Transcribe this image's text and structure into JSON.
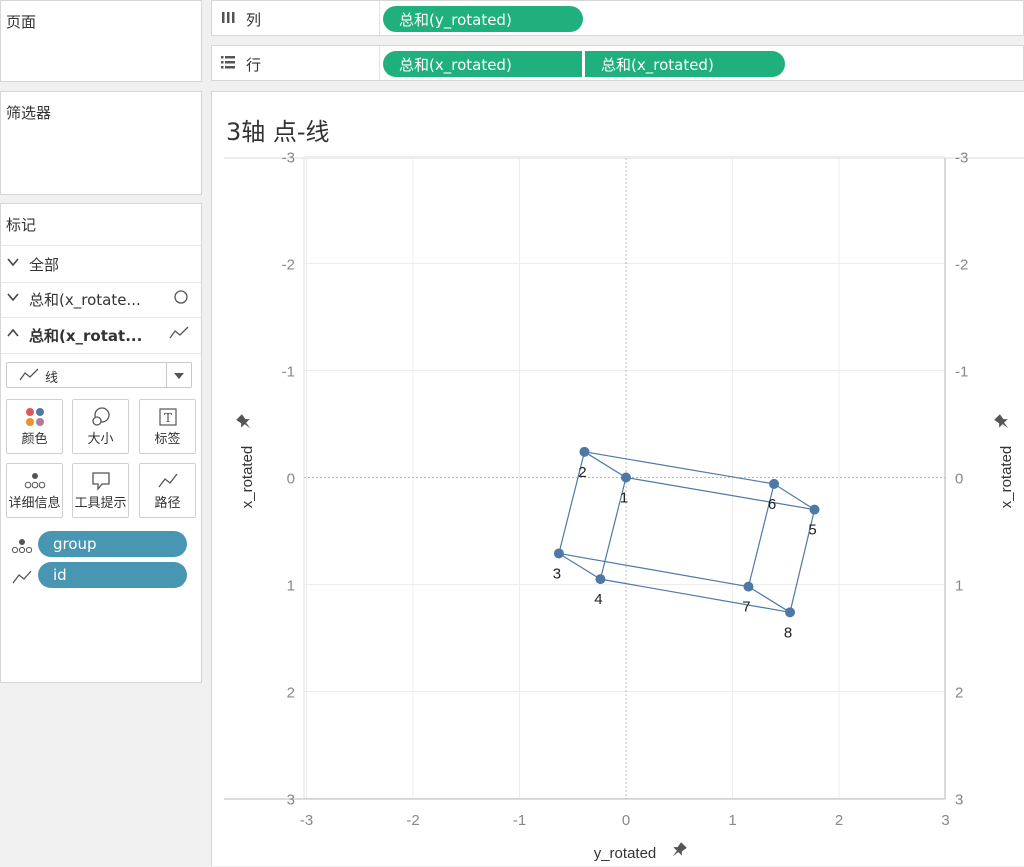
{
  "pages": {
    "title": "页面"
  },
  "filters": {
    "title": "筛选器"
  },
  "marks": {
    "title": "标记",
    "rows": [
      {
        "label": "全部",
        "chevron": "chevron-down",
        "bold": false,
        "icon": ""
      },
      {
        "label": "总和(x_rotate...",
        "chevron": "chevron-down",
        "bold": false,
        "icon": "circle-icon"
      },
      {
        "label": "总和(x_rotat...",
        "chevron": "chevron-up",
        "bold": true,
        "icon": "line-icon"
      }
    ],
    "mark_type": "线",
    "buttons": [
      {
        "label": "颜色",
        "icon": "color-dots-icon"
      },
      {
        "label": "大小",
        "icon": "size-icon"
      },
      {
        "label": "标签",
        "icon": "label-text-icon"
      },
      {
        "label": "详细信息",
        "icon": "detail-dots-icon"
      },
      {
        "label": "工具提示",
        "icon": "tooltip-icon"
      },
      {
        "label": "路径",
        "icon": "path-icon"
      }
    ],
    "fields": [
      {
        "label": "group",
        "icon": "detail-dots-icon"
      },
      {
        "label": "id",
        "icon": "path-icon"
      }
    ]
  },
  "shelves": {
    "columns": {
      "label": "列",
      "icon": "columns-icon",
      "pills": [
        "总和(y_rotated)"
      ]
    },
    "rows": {
      "label": "行",
      "icon": "rows-icon",
      "pills": [
        "总和(x_rotated)",
        "总和(x_rotated)"
      ]
    }
  },
  "colors": {
    "green_pill": "#1fb07d",
    "blue_pill": "#4996b2",
    "mark": "#4e79a7"
  },
  "viz": {
    "title": "3轴 点-线"
  },
  "chart_data": {
    "type": "line",
    "x_axis": {
      "label": "y_rotated",
      "range": [
        -3,
        3
      ],
      "ticks": [
        "-3",
        "-2",
        "-1",
        "0",
        "1",
        "2",
        "3"
      ],
      "pinned": true
    },
    "y_axis_left": {
      "label": "x_rotated",
      "range": [
        -3,
        3
      ],
      "reversed": true,
      "ticks": [
        "-3",
        "-2",
        "-1",
        "0",
        "1",
        "2",
        "3"
      ],
      "pinned": true
    },
    "y_axis_right": {
      "label": "x_rotated",
      "range": [
        -3,
        3
      ],
      "reversed": true,
      "ticks": [
        "-3",
        "-2",
        "-1",
        "0",
        "1",
        "2",
        "3"
      ],
      "pinned": true
    },
    "grid": true,
    "zero_lines": true,
    "points": [
      {
        "id": "1",
        "x": 0.0,
        "y": 0.0
      },
      {
        "id": "2",
        "x": -0.39,
        "y": -0.24
      },
      {
        "id": "3",
        "x": -0.63,
        "y": 0.71
      },
      {
        "id": "4",
        "x": -0.24,
        "y": 0.95
      },
      {
        "id": "5",
        "x": 1.77,
        "y": 0.3
      },
      {
        "id": "6",
        "x": 1.39,
        "y": 0.06
      },
      {
        "id": "7",
        "x": 1.15,
        "y": 1.02
      },
      {
        "id": "8",
        "x": 1.54,
        "y": 1.26
      }
    ],
    "paths": [
      [
        "2",
        "1",
        "5",
        "6",
        "2",
        "3",
        "4",
        "8",
        "7",
        "3"
      ],
      [
        "1",
        "4"
      ],
      [
        "6",
        "7"
      ],
      [
        "5",
        "8"
      ]
    ]
  }
}
